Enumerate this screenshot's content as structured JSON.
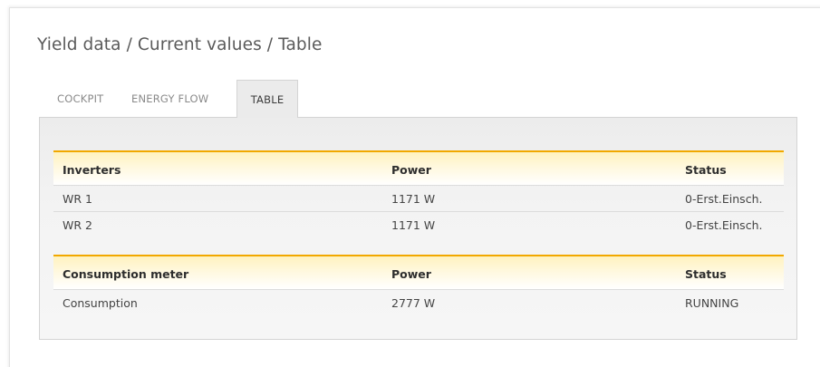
{
  "page_title": "Yield data / Current values / Table",
  "tabs": [
    {
      "label": "COCKPIT",
      "active": false
    },
    {
      "label": "ENERGY FLOW",
      "active": false
    },
    {
      "label": "TABLE",
      "active": true
    }
  ],
  "inverters_table": {
    "headers": [
      "Inverters",
      "Power",
      "Status"
    ],
    "rows": [
      [
        "WR 1",
        "1171 W",
        "0-Erst.Einsch."
      ],
      [
        "WR 2",
        "1171 W",
        "0-Erst.Einsch."
      ]
    ]
  },
  "consumption_table": {
    "headers": [
      "Consumption meter",
      "Power",
      "Status"
    ],
    "rows": [
      [
        "Consumption",
        "2777 W",
        "RUNNING"
      ]
    ]
  },
  "colors": {
    "header_accent": "#f1a800",
    "header_gradient_top": "#fff2bf",
    "active_tab_bg": "#ebebeb"
  }
}
